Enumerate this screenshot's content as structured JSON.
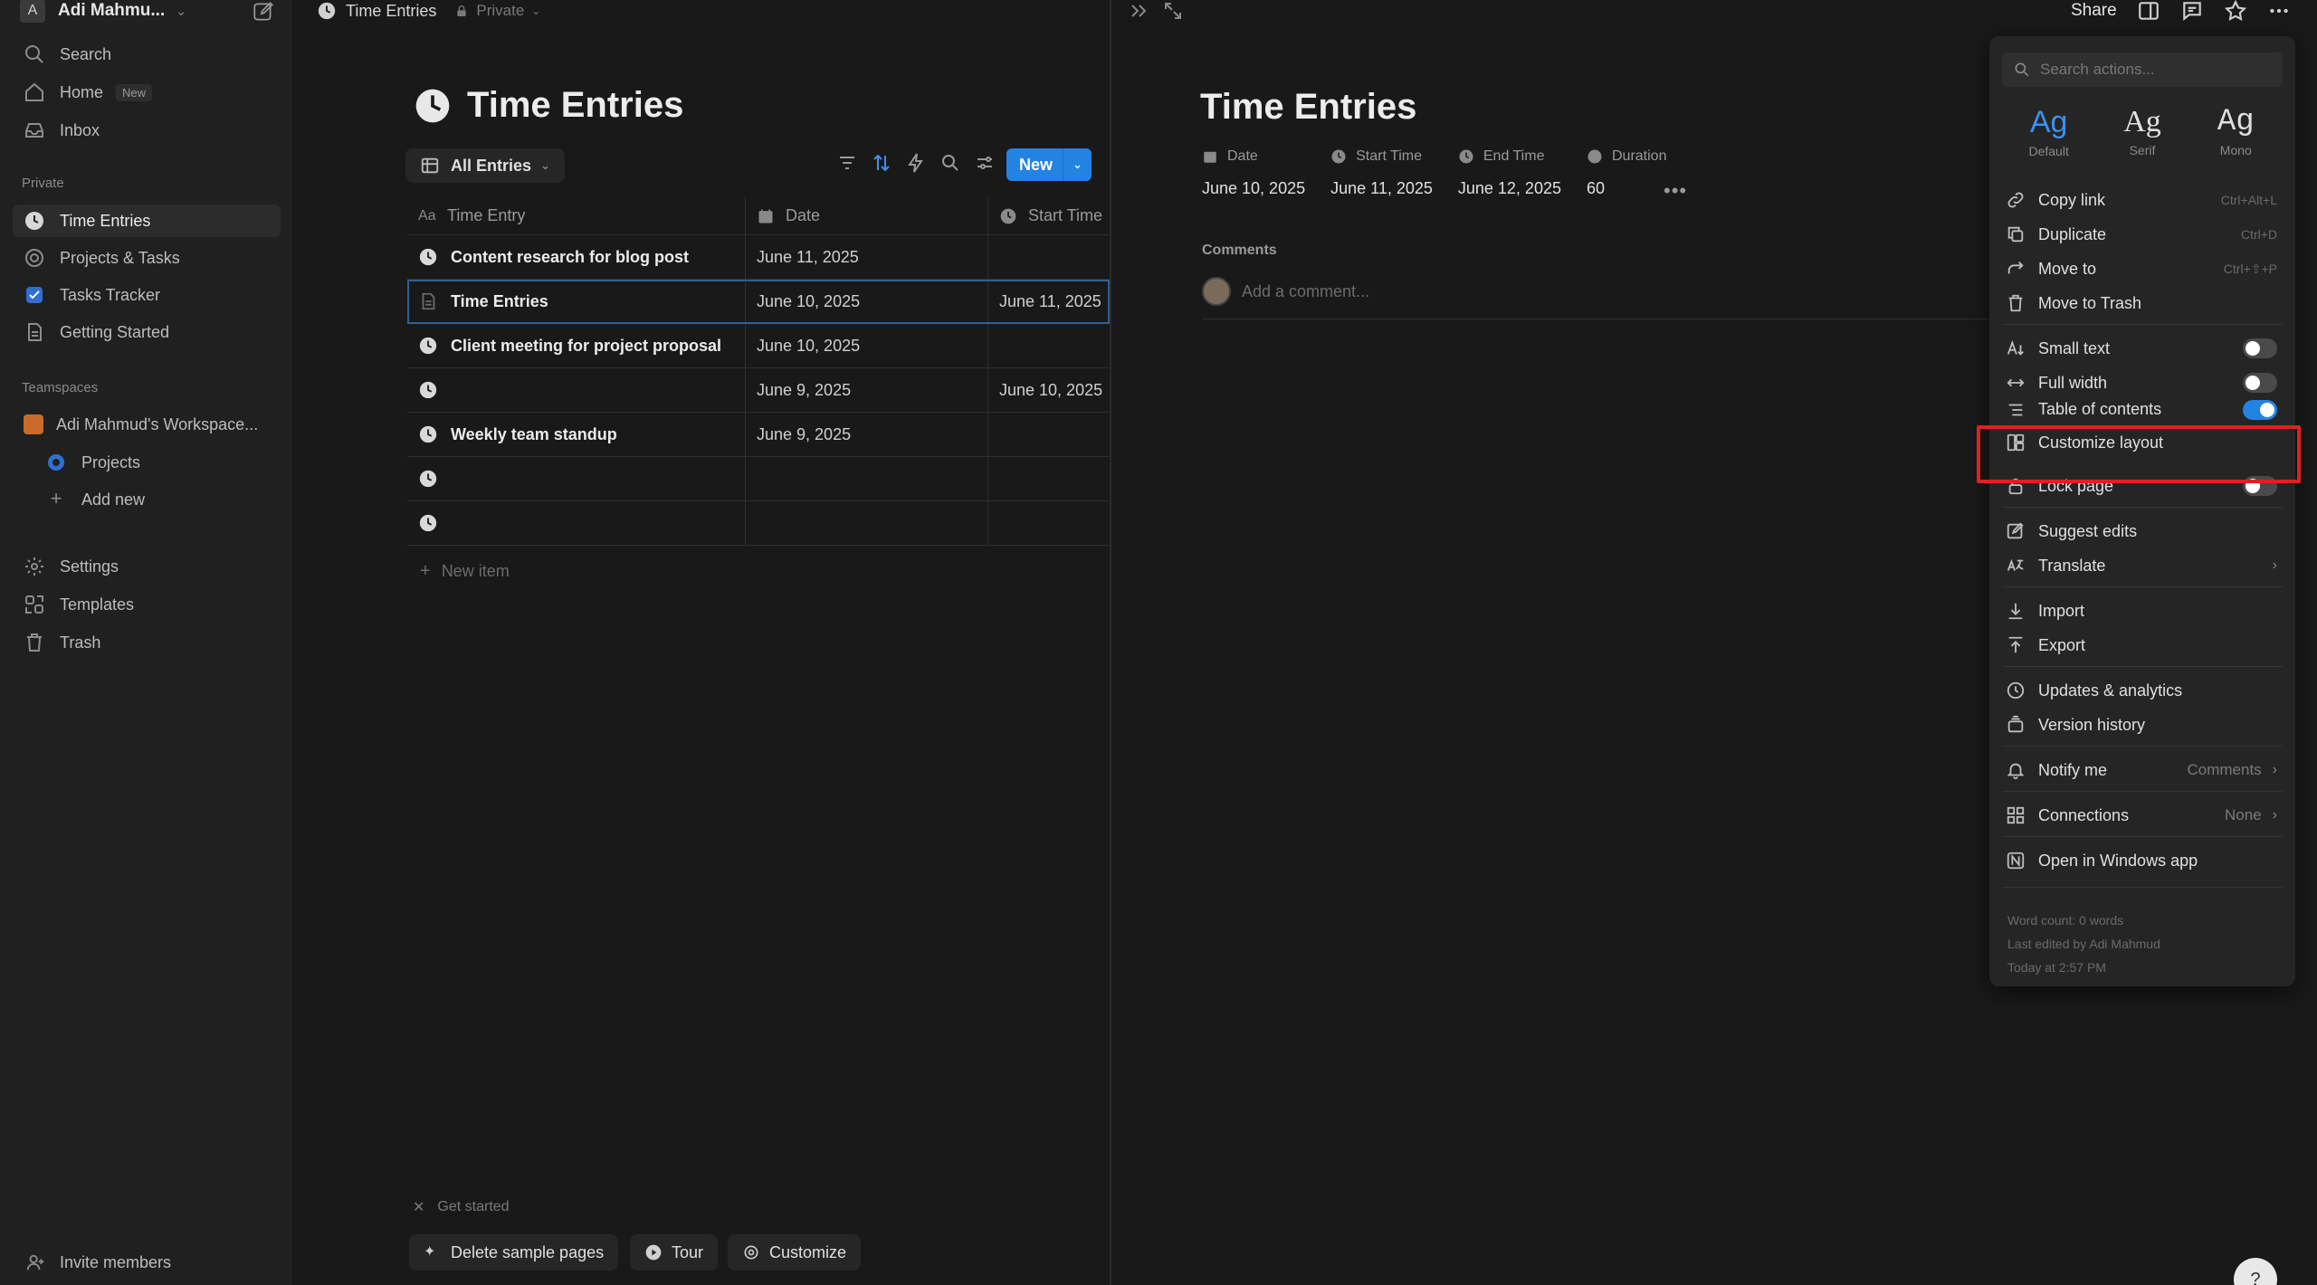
{
  "sidebar": {
    "workspace_initial": "A",
    "workspace_name": "Adi Mahmu...",
    "nav": {
      "search": "Search",
      "home": "Home",
      "home_badge": "New",
      "inbox": "Inbox"
    },
    "private_label": "Private",
    "private_items": [
      "Time Entries",
      "Projects & Tasks",
      "Tasks Tracker",
      "Getting Started"
    ],
    "teamspaces_label": "Teamspaces",
    "teamspace_name": "Adi Mahmud's Workspace...",
    "teamspace_items": [
      "Projects",
      "Add new"
    ],
    "bottom_items": [
      "Settings",
      "Templates",
      "Trash"
    ],
    "invite": "Invite members"
  },
  "breadcrumb": {
    "title": "Time Entries",
    "privacy": "Private"
  },
  "database": {
    "title": "Time Entries",
    "view_name": "All Entries",
    "new_button": "New",
    "columns": [
      "Time Entry",
      "Date",
      "Start Time"
    ],
    "rows": [
      {
        "name": "Content research for blog post",
        "date": "June 11, 2025",
        "start": ""
      },
      {
        "name": "Time Entries",
        "date": "June 10, 2025",
        "start": "June 11, 2025"
      },
      {
        "name": "Client meeting for project proposal",
        "date": "June 10, 2025",
        "start": ""
      },
      {
        "name": "",
        "date": "June 9, 2025",
        "start": "June 10, 2025"
      },
      {
        "name": "Weekly team standup",
        "date": "June 9, 2025",
        "start": ""
      },
      {
        "name": "",
        "date": "",
        "start": ""
      },
      {
        "name": "",
        "date": "",
        "start": ""
      }
    ],
    "new_item": "New item"
  },
  "onboarding": {
    "get_started": "Get started",
    "delete_sample": "Delete sample pages",
    "tour": "Tour",
    "customize": "Customize"
  },
  "peek": {
    "title": "Time Entries",
    "properties": [
      {
        "label": "Date",
        "value": "June 10, 2025"
      },
      {
        "label": "Start Time",
        "value": "June 11, 2025"
      },
      {
        "label": "End Time",
        "value": "June 12, 2025"
      },
      {
        "label": "Duration",
        "value": "60"
      }
    ],
    "comments_label": "Comments",
    "comment_placeholder": "Add a comment..."
  },
  "topbar": {
    "share": "Share"
  },
  "menu": {
    "search_placeholder": "Search actions...",
    "fonts": [
      {
        "glyph": "Ag",
        "label": "Default"
      },
      {
        "glyph": "Ag",
        "label": "Serif"
      },
      {
        "glyph": "Ag",
        "label": "Mono"
      }
    ],
    "copy_link": "Copy link",
    "copy_link_sc": "Ctrl+Alt+L",
    "duplicate": "Duplicate",
    "duplicate_sc": "Ctrl+D",
    "move_to": "Move to",
    "move_to_sc": "Ctrl+⇧+P",
    "move_to_trash": "Move to Trash",
    "small_text": "Small text",
    "full_width": "Full width",
    "table_of_contents": "Table of contents",
    "customize_layout": "Customize layout",
    "lock_page": "Lock page",
    "suggest_edits": "Suggest edits",
    "translate": "Translate",
    "import": "Import",
    "export": "Export",
    "updates_analytics": "Updates & analytics",
    "version_history": "Version history",
    "notify_me": "Notify me",
    "notify_value": "Comments",
    "connections": "Connections",
    "connections_value": "None",
    "open_windows": "Open in Windows app",
    "footer_words": "Word count: 0 words",
    "footer_edited": "Last edited by Adi Mahmud",
    "footer_time": "Today at 2:57 PM"
  },
  "colors": {
    "accent": "#2383e2",
    "highlight": "#e02020"
  }
}
